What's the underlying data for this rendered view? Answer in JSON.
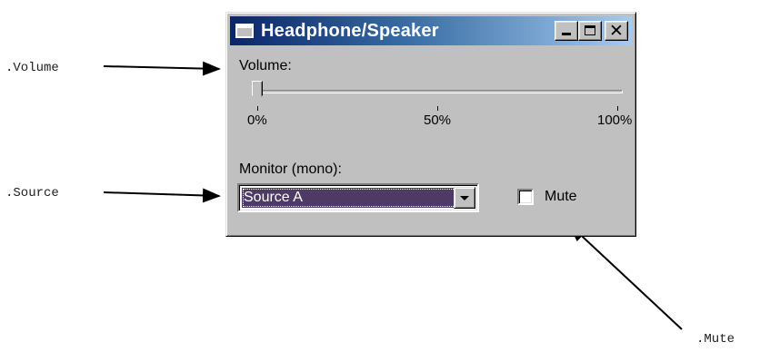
{
  "window": {
    "title": "Headphone/Speaker"
  },
  "volume": {
    "label": "Volume:",
    "value_percent": 0,
    "ticks": [
      "0%",
      "50%",
      "100%"
    ]
  },
  "monitor": {
    "label": "Monitor (mono):",
    "selected": "Source A"
  },
  "mute": {
    "label": "Mute",
    "checked": false
  },
  "callouts": {
    "volume": ".Volume",
    "source": ".Source",
    "mute": ".Mute"
  },
  "colors": {
    "titlebar_start": "#0a246a",
    "titlebar_end": "#a6caf0",
    "window_face": "#c0c0c0",
    "selection": "#4d3b66"
  },
  "icons": [
    "window-app-icon",
    "minimize-icon",
    "maximize-icon",
    "close-icon",
    "dropdown-arrow-icon",
    "annotation-arrow"
  ]
}
